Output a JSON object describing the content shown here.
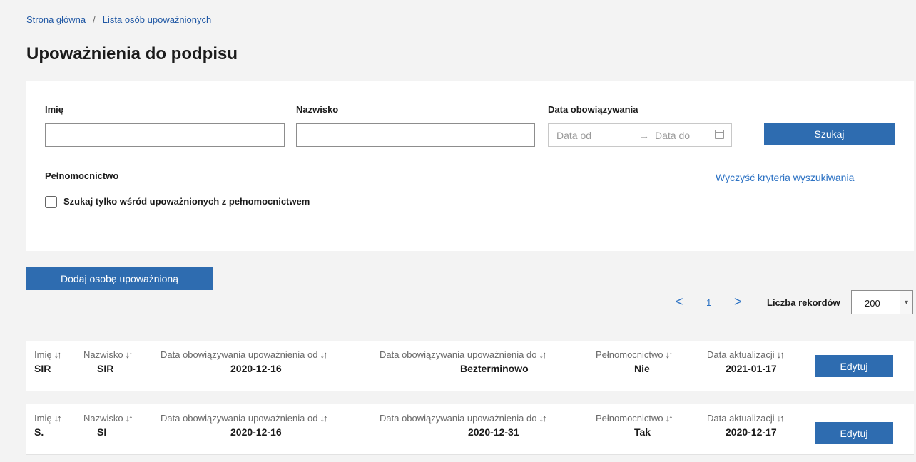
{
  "breadcrumb": {
    "home": "Strona główna",
    "separator": "/",
    "current": "Lista osób upoważnionych"
  },
  "page": {
    "title": "Upoważnienia do podpisu"
  },
  "filters": {
    "first_name_label": "Imię",
    "first_name_value": "",
    "last_name_label": "Nazwisko",
    "last_name_value": "",
    "date_label": "Data obowiązywania",
    "date_from_placeholder": "Data od",
    "date_arrow": "→",
    "date_to_placeholder": "Data do",
    "search_button": "Szukaj",
    "power_of_attorney_label": "Pełnomocnictwo",
    "checkbox_label": "Szukaj tylko wśród upoważnionych z pełnomocnictwem",
    "checkbox_checked": false,
    "clear_link": "Wyczyść kryteria wyszukiwania"
  },
  "actions": {
    "add_button": "Dodaj osobę upoważnioną"
  },
  "pagination": {
    "prev": "<",
    "page": "1",
    "next": ">",
    "records_label": "Liczba rekordów",
    "records_value": "200"
  },
  "columns": {
    "first_name": "Imię",
    "last_name": "Nazwisko",
    "valid_from": "Data obowiązywania upoważnienia od",
    "valid_to": "Data obowiązywania upoważnienia do",
    "power": "Pełnomocnictwo",
    "updated": "Data aktualizacji",
    "sort_glyph": "↓↑"
  },
  "rows": [
    {
      "first_name": "SIR",
      "last_name": "SIR",
      "valid_from": "2020-12-16",
      "valid_to": "Bezterminowo",
      "power": "Nie",
      "updated": "2021-01-17",
      "edit": "Edytuj"
    },
    {
      "first_name": "S.",
      "last_name": "SI",
      "valid_from": "2020-12-16",
      "valid_to": "2020-12-31",
      "power": "Tak",
      "updated": "2020-12-17",
      "edit": "Edytuj"
    }
  ],
  "colors": {
    "primary": "#2e6cb0",
    "link": "#2e73c4",
    "frame": "#4a7cc8"
  }
}
